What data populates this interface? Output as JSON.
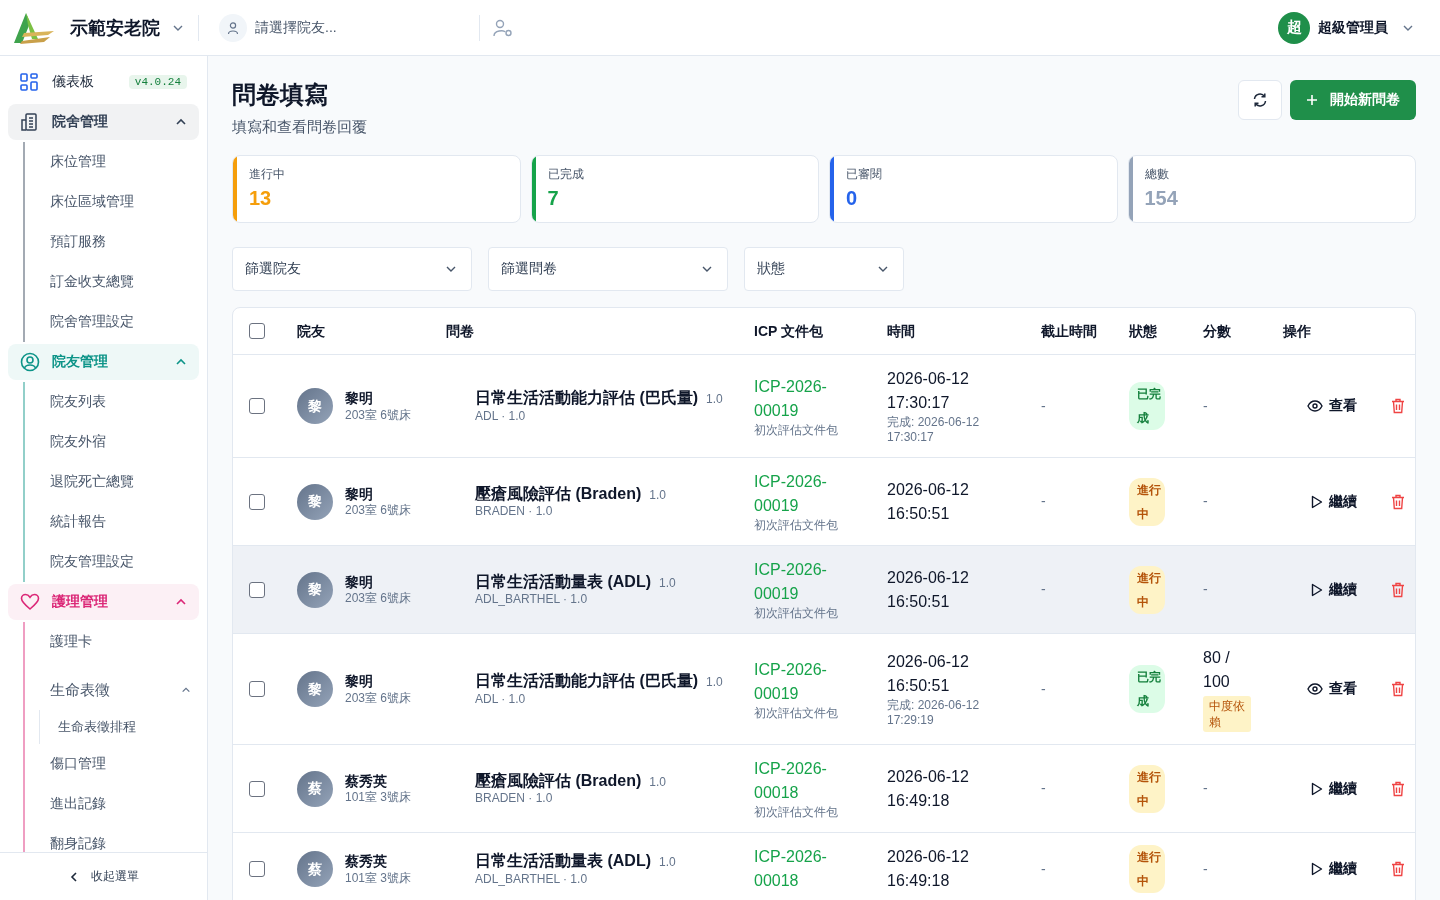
{
  "header": {
    "facility": "示範安老院",
    "resident_placeholder": "請選擇院友...",
    "user": {
      "avatar": "超",
      "name": "超級管理員"
    }
  },
  "sidebar": {
    "items": [
      {
        "kind": "link",
        "label": "儀表板",
        "badge": "v4.0.24"
      },
      {
        "kind": "group",
        "label": "院舍管理",
        "color": "#334155",
        "expanded": true,
        "children": [
          {
            "label": "床位管理"
          },
          {
            "label": "床位區域管理"
          },
          {
            "label": "預訂服務"
          },
          {
            "label": "訂金收支總覽"
          },
          {
            "label": "院舍管理設定"
          }
        ]
      },
      {
        "kind": "group",
        "label": "院友管理",
        "color": "#0d9488",
        "expanded": true,
        "children": [
          {
            "label": "院友列表"
          },
          {
            "label": "院友外宿"
          },
          {
            "label": "退院死亡總覽"
          },
          {
            "label": "統計報告"
          },
          {
            "label": "院友管理設定"
          }
        ]
      },
      {
        "kind": "group",
        "label": "護理管理",
        "color": "#db2777",
        "expanded": true,
        "children": [
          {
            "label": "護理卡"
          },
          {
            "label": "生命表徵",
            "expanded": true,
            "children": [
              {
                "label": "生命表徵排程"
              }
            ]
          },
          {
            "label": "傷口管理"
          },
          {
            "label": "進出記錄"
          },
          {
            "label": "翻身記錄"
          }
        ]
      }
    ],
    "collapse_label": "收起選單"
  },
  "page": {
    "title": "問卷填寫",
    "subtitle": "填寫和查看問卷回覆",
    "new_button": "開始新問卷"
  },
  "stats": [
    {
      "label": "進行中",
      "value": "13",
      "color": "#f59e0b"
    },
    {
      "label": "已完成",
      "value": "7",
      "color": "#16a34a"
    },
    {
      "label": "已審閱",
      "value": "0",
      "color": "#2563eb"
    },
    {
      "label": "總數",
      "value": "154",
      "color": "#94a3b8"
    }
  ],
  "filters": [
    {
      "label": "篩選院友"
    },
    {
      "label": "篩選問卷"
    },
    {
      "label": "狀態"
    }
  ],
  "table": {
    "all_selected": false,
    "columns": [
      "院友",
      "問卷",
      "ICP 文件包",
      "時間",
      "截止時間",
      "狀態",
      "分數",
      "操作"
    ],
    "rows": [
      {
        "selected": false,
        "hovered": false,
        "avatar": "黎",
        "name": "黎明",
        "room": "203室 6號床",
        "title": "日常生活活動能力評估 (巴氏量)",
        "version": "1.0",
        "code": "ADL · 1.0",
        "icp": "ICP-2026-00019",
        "icp_pack": "初次評估文件包",
        "time": "2026-06-12 17:30:17",
        "completed": "完成: 2026-06-12 17:30:17",
        "deadline": "-",
        "status": {
          "kind": "done",
          "label": "已完成"
        },
        "score": "-",
        "action": {
          "kind": "view",
          "label": "查看"
        }
      },
      {
        "selected": false,
        "hovered": false,
        "avatar": "黎",
        "name": "黎明",
        "room": "203室 6號床",
        "title": "壓瘡風險評估 (Braden)",
        "version": "1.0",
        "code": "BRADEN · 1.0",
        "icp": "ICP-2026-00019",
        "icp_pack": "初次評估文件包",
        "time": "2026-06-12 16:50:51",
        "deadline": "-",
        "status": {
          "kind": "progress",
          "label": "進行中"
        },
        "score": "-",
        "action": {
          "kind": "continue",
          "label": "繼續"
        }
      },
      {
        "selected": false,
        "hovered": true,
        "avatar": "黎",
        "name": "黎明",
        "room": "203室 6號床",
        "title": "日常生活活動量表 (ADL)",
        "version": "1.0",
        "code": "ADL_BARTHEL · 1.0",
        "icp": "ICP-2026-00019",
        "icp_pack": "初次評估文件包",
        "time": "2026-06-12 16:50:51",
        "deadline": "-",
        "status": {
          "kind": "progress",
          "label": "進行中"
        },
        "score": "-",
        "action": {
          "kind": "continue",
          "label": "繼續"
        }
      },
      {
        "selected": false,
        "hovered": false,
        "avatar": "黎",
        "name": "黎明",
        "room": "203室 6號床",
        "title": "日常生活活動能力評估 (巴氏量)",
        "version": "1.0",
        "code": "ADL · 1.0",
        "icp": "ICP-2026-00019",
        "icp_pack": "初次評估文件包",
        "time": "2026-06-12 16:50:51",
        "completed": "完成: 2026-06-12 17:29:19",
        "deadline": "-",
        "status": {
          "kind": "done",
          "label": "已完成"
        },
        "score": "80 / 100",
        "score_level": "中度依賴",
        "action": {
          "kind": "view",
          "label": "查看"
        }
      },
      {
        "selected": false,
        "hovered": false,
        "avatar": "蔡",
        "name": "蔡秀英",
        "room": "101室 3號床",
        "title": "壓瘡風險評估 (Braden)",
        "version": "1.0",
        "code": "BRADEN · 1.0",
        "icp": "ICP-2026-00018",
        "icp_pack": "初次評估文件包",
        "time": "2026-06-12 16:49:18",
        "deadline": "-",
        "status": {
          "kind": "progress",
          "label": "進行中"
        },
        "score": "-",
        "action": {
          "kind": "continue",
          "label": "繼續"
        }
      },
      {
        "selected": false,
        "hovered": false,
        "avatar": "蔡",
        "name": "蔡秀英",
        "room": "101室 3號床",
        "title": "日常生活活動量表 (ADL)",
        "version": "1.0",
        "code": "ADL_BARTHEL · 1.0",
        "icp": "ICP-2026-00018",
        "time": "2026-06-12 16:49:18",
        "deadline": "-",
        "status": {
          "kind": "progress",
          "label": "進行中"
        },
        "score": "-",
        "action": {
          "kind": "continue",
          "label": "繼續"
        }
      }
    ]
  }
}
